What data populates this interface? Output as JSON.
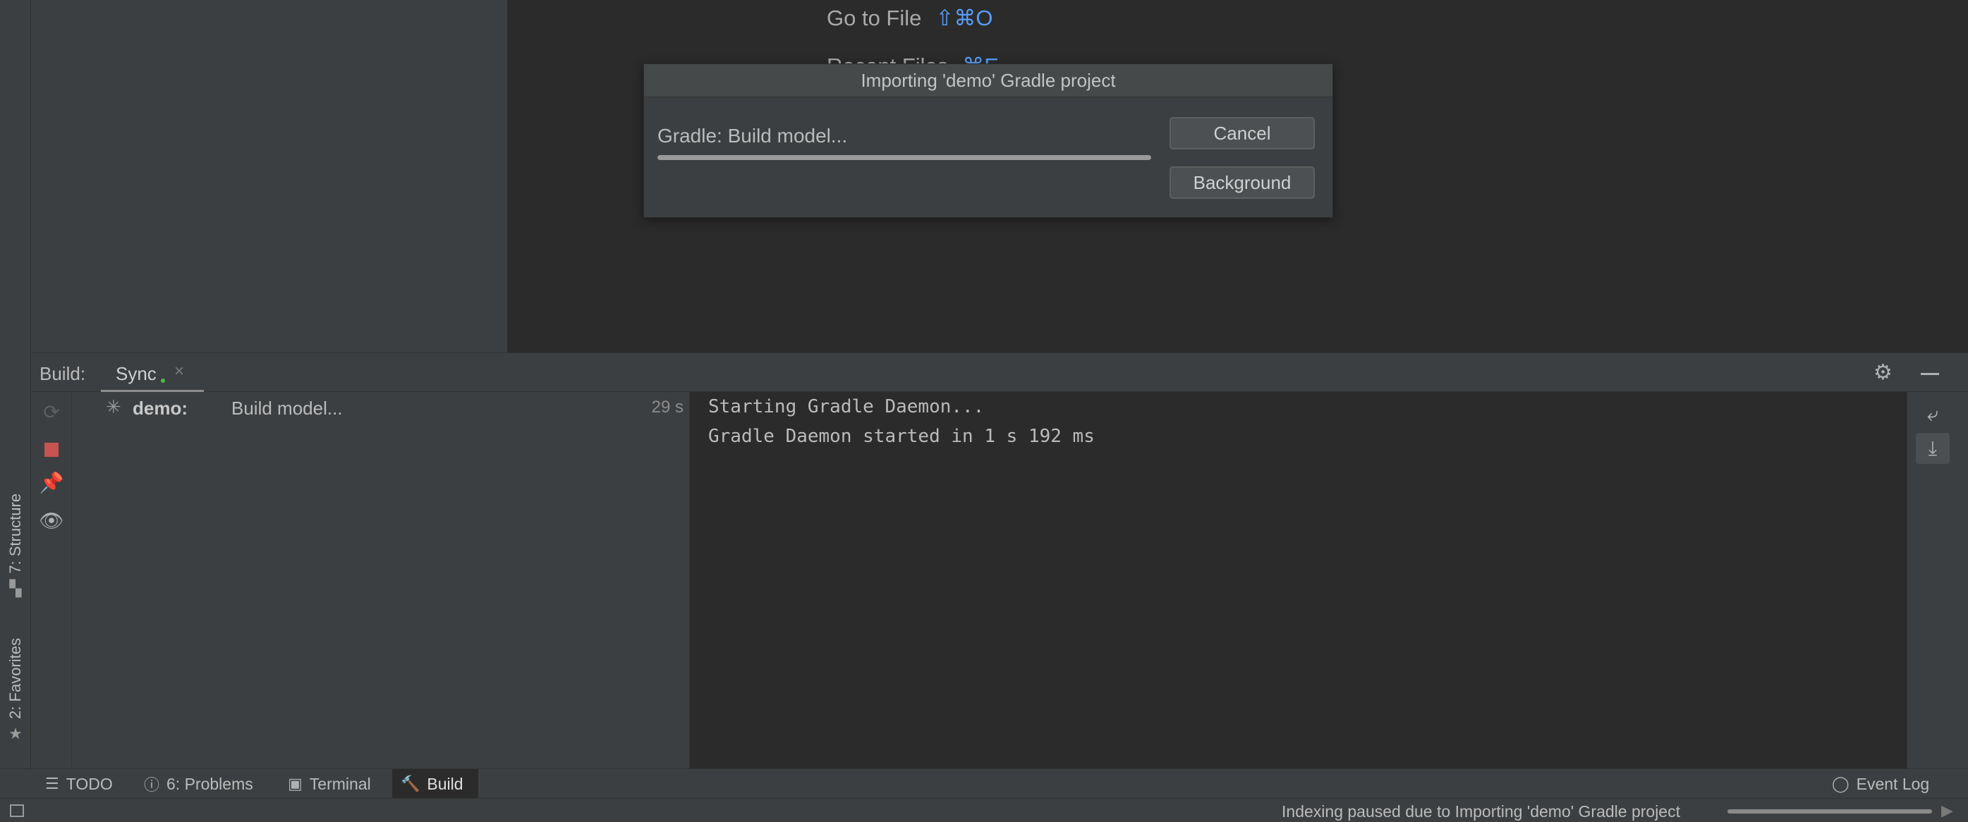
{
  "editor": {
    "hints": [
      {
        "label": "Go to File",
        "shortcut": "⇧⌘O"
      },
      {
        "label": "Recent Files",
        "shortcut": "⌘E"
      }
    ]
  },
  "dialog": {
    "title": "Importing 'demo' Gradle project",
    "status": "Gradle: Build model...",
    "progress_fraction": 1.0,
    "cancel_label": "Cancel",
    "background_label": "Background"
  },
  "build": {
    "title": "Build:",
    "tab_label": "Sync",
    "close_glyph": "×",
    "tree": {
      "project": "demo:",
      "task": "Build model...",
      "time": "29 s"
    },
    "console": [
      "Starting Gradle Daemon...",
      "Gradle Daemon started in 1 s 192 ms"
    ]
  },
  "left_strip": {
    "structure": "7: Structure",
    "favorites": "2: Favorites"
  },
  "bottom_tabs": {
    "todo": "TODO",
    "problems": "6: Problems",
    "terminal": "Terminal",
    "build": "Build",
    "event_log": "Event Log"
  },
  "status_bar": {
    "message": "Indexing paused due to Importing 'demo' Gradle project",
    "progress_fraction": 1.0
  },
  "icons": {
    "sync": "sync-icon",
    "stop": "stop-icon",
    "pin": "pin-icon",
    "eye": "eye-icon",
    "gear": "gear-icon",
    "minimize": "minimize-icon",
    "soft_wrap": "soft-wrap-icon",
    "scroll_to_end": "scroll-to-end-icon"
  },
  "colors": {
    "shortcut": "#589df6",
    "stop": "#c75450",
    "sync_dot": "#48c048"
  }
}
